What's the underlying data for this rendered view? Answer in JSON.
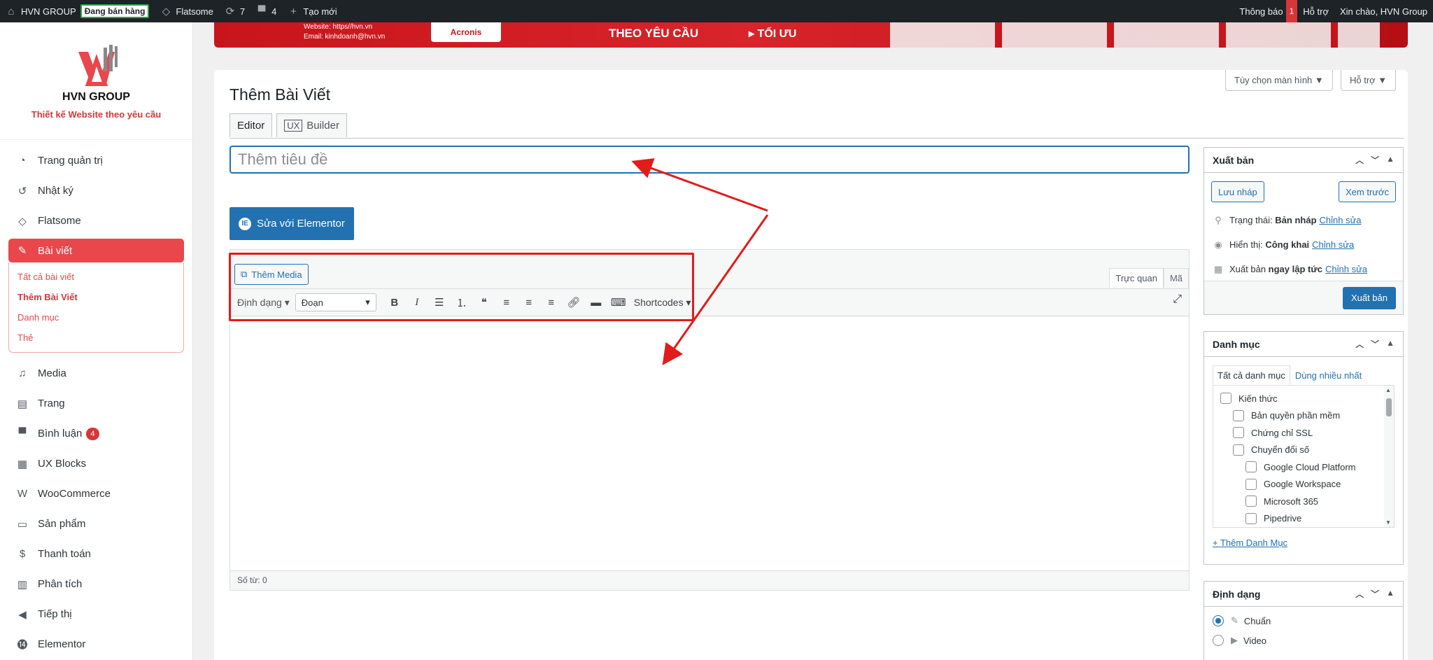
{
  "adminbar": {
    "site_name": "HVN GROUP",
    "sale_badge": "Đang bán hàng",
    "theme": "Flatsome",
    "updates_count": "7",
    "comments_count": "4",
    "new_label": "Tạo mới",
    "notifications_label": "Thông báo",
    "notifications_count": "1",
    "help_label": "Hỗ trợ",
    "greeting": "Xin chào, HVN Group"
  },
  "brand": {
    "name": "HVN GROUP",
    "tagline": "Thiết kế Website theo yêu cầu"
  },
  "sidebar": {
    "items": [
      {
        "label": "Trang quản trị",
        "icon": "dashboard-icon"
      },
      {
        "label": "Nhật ký",
        "icon": "history-icon"
      },
      {
        "label": "Flatsome",
        "icon": "flatsome-icon"
      },
      {
        "label": "Bài viết",
        "icon": "pin-icon"
      },
      {
        "label": "Media",
        "icon": "media-icon"
      },
      {
        "label": "Trang",
        "icon": "page-icon"
      },
      {
        "label": "Bình luận",
        "icon": "comment-icon",
        "badge": "4"
      },
      {
        "label": "UX Blocks",
        "icon": "blocks-icon"
      },
      {
        "label": "WooCommerce",
        "icon": "woo-icon"
      },
      {
        "label": "Sản phẩm",
        "icon": "product-icon"
      },
      {
        "label": "Thanh toán",
        "icon": "payment-icon"
      },
      {
        "label": "Phân tích",
        "icon": "chart-icon"
      },
      {
        "label": "Tiếp thị",
        "icon": "megaphone-icon"
      },
      {
        "label": "Elementor",
        "icon": "elementor-icon"
      }
    ],
    "posts_submenu": [
      "Tất cả bài viết",
      "Thêm Bài Viết",
      "Danh mục",
      "Thẻ"
    ]
  },
  "banner": {
    "website": "Website: https//hvn.vn",
    "email": "Email: kinhdoanh@hvn.vn",
    "partner": "Acronis",
    "headline": "THEO YÊU CẦU",
    "cta": "▸ TỐI ƯU"
  },
  "screen": {
    "options_label": "Tùy chọn màn hình ▼",
    "help_label": "Hỗ trợ ▼"
  },
  "page": {
    "title": "Thêm Bài Viết",
    "tab_editor": "Editor",
    "tab_ux_badge": "UX",
    "tab_ux_label": "Builder",
    "title_placeholder": "Thêm tiêu đề",
    "elementor_button": "Sửa với Elementor"
  },
  "editor": {
    "add_media": "Thêm Media",
    "tab_visual": "Trực quan",
    "tab_code": "Mã",
    "format_dropdown": "Định dạng",
    "block_select": "Đoạn",
    "shortcodes": "Shortcodes",
    "word_count": "Số từ: 0"
  },
  "publish": {
    "title": "Xuất bản",
    "save_draft": "Lưu nháp",
    "preview": "Xem trước",
    "status_label": "Trạng thái:",
    "status_value": "Bản nháp",
    "visibility_label": "Hiển thị:",
    "visibility_value": "Công khai",
    "schedule_label": "Xuất bản",
    "schedule_value": "ngay lập tức",
    "edit_link": "Chỉnh sửa",
    "publish_button": "Xuất bản"
  },
  "categories": {
    "title": "Danh mục",
    "tab_all": "Tất cả danh mục",
    "tab_popular": "Dùng nhiều nhất",
    "items": [
      {
        "label": "Kiến thức",
        "level": 0
      },
      {
        "label": "Bản quyền phần mềm",
        "level": 1
      },
      {
        "label": "Chứng chỉ SSL",
        "level": 1
      },
      {
        "label": "Chuyển đổi số",
        "level": 1
      },
      {
        "label": "Google Cloud Platform",
        "level": 2
      },
      {
        "label": "Google Workspace",
        "level": 2
      },
      {
        "label": "Microsoft 365",
        "level": 2
      },
      {
        "label": "Pipedrive",
        "level": 2
      }
    ],
    "add_new": "+ Thêm Danh Mục"
  },
  "format": {
    "title": "Định dạng",
    "options": [
      {
        "label": "Chuẩn",
        "checked": true
      },
      {
        "label": "Video",
        "checked": false
      }
    ]
  },
  "colors": {
    "accent": "#e8474c",
    "primary": "#2271b1",
    "annotation": "#e21b1b"
  }
}
